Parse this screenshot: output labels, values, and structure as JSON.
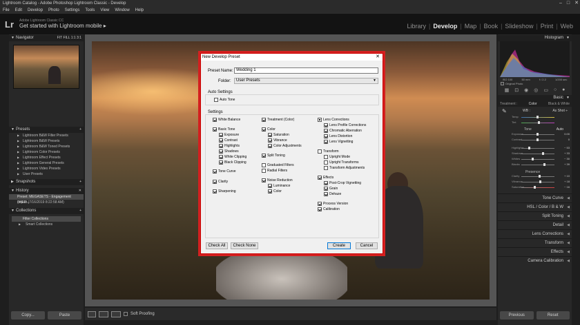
{
  "window": {
    "title": "Lightroom Catalog - Adobe Photoshop Lightroom Classic - Develop"
  },
  "menu": [
    "File",
    "Edit",
    "Develop",
    "Photo",
    "Settings",
    "Tools",
    "View",
    "Window",
    "Help"
  ],
  "identity": {
    "logo": "Lr",
    "product": "Adobe Lightroom Classic CC",
    "tagline": "Get started with Lightroom mobile ▸"
  },
  "modules": [
    "Library",
    "Develop",
    "Map",
    "Book",
    "Slideshow",
    "Print",
    "Web"
  ],
  "active_module": "Develop",
  "left": {
    "navigator": {
      "title": "Navigator",
      "options": [
        "FIT",
        "FILL",
        "1:1",
        "3:1"
      ]
    },
    "presets": {
      "title": "Presets",
      "items": [
        "Lightroom B&W Filter Presets",
        "Lightroom B&W Presets",
        "Lightroom B&W Toned Presets",
        "Lightroom Color Presets",
        "Lightroom Effect Presets",
        "Lightroom General Presets",
        "Lightroom Video Presets",
        "User Presets"
      ]
    },
    "snapshots": {
      "title": "Snapshots"
    },
    "history": {
      "title": "History",
      "items": [
        "Preset: MEGASETS - Engagement (WED...",
        "Import (7/16/2019 8:22:58 AM)"
      ]
    },
    "collections": {
      "title": "Collections",
      "items": [
        "Filter Collections",
        "Smart Collections"
      ]
    },
    "copy_label": "Copy...",
    "paste_label": "Paste"
  },
  "toolbar": {
    "soft_proofing": "Soft Proofing"
  },
  "dialog": {
    "title": "New Develop Preset",
    "preset_name_label": "Preset Name:",
    "preset_name_value": "Wedding 1",
    "folder_label": "Folder:",
    "folder_value": "User Presets",
    "auto_settings_label": "Auto Settings",
    "auto_tone": "Auto Tone",
    "settings_label": "Settings",
    "col1": [
      "White Balance",
      "Basic Tone",
      "Exposure",
      "Contrast",
      "Highlights",
      "Shadows",
      "White Clipping",
      "Black Clipping",
      "Tone Curve",
      "Clarity",
      "Sharpening"
    ],
    "col2": [
      "Treatment (Color)",
      "Color",
      "Saturation",
      "Vibrance",
      "Color Adjustments",
      "Split Toning",
      "Graduated Filters",
      "Radial Filters",
      "Noise Reduction",
      "Luminance",
      "Color"
    ],
    "col3": [
      "Lens Corrections",
      "Lens Profile Corrections",
      "Chromatic Aberration",
      "Lens Distortion",
      "Lens Vignetting",
      "Transform",
      "Upright Mode",
      "Upright Transforms",
      "Transform Adjustments",
      "Effects",
      "Post-Crop Vignetting",
      "Grain",
      "Dehaze",
      "Process Version",
      "Calibration"
    ],
    "check_all": "Check All",
    "check_none": "Check None",
    "create": "Create",
    "cancel": "Cancel"
  },
  "right": {
    "histogram": {
      "title": "Histogram",
      "info": [
        "ISO 100",
        "50 mm",
        "f / 2.2",
        "1/200 sec"
      ],
      "original_photo": "Original Photo"
    },
    "basic": {
      "title": "Basic",
      "treatment_label": "Treatment :",
      "color": "Color",
      "bw": "Black & White",
      "wb_label": "WB :",
      "wb_value": "As Shot ÷",
      "temp": "Temp",
      "tint": "Tint",
      "tone": "Tone",
      "auto": "Auto",
      "sliders": [
        {
          "name": "Exposure",
          "value": "0.00"
        },
        {
          "name": "Contrast",
          "value": "0"
        },
        {
          "name": "Highlights",
          "value": "− 53"
        },
        {
          "name": "Shadows",
          "value": "+ 33"
        },
        {
          "name": "Whites",
          "value": "− 30"
        },
        {
          "name": "Blacks",
          "value": "+ 39"
        }
      ],
      "presence": "Presence",
      "presence_sliders": [
        {
          "name": "Clarity",
          "value": "+ 10"
        },
        {
          "name": "Vibrance",
          "value": "+ 18"
        },
        {
          "name": "Saturation",
          "value": "− 16"
        }
      ]
    },
    "sections": [
      "Tone Curve",
      "HSL / Color / B & W",
      "Split Toning",
      "Detail",
      "Lens Corrections",
      "Transform",
      "Effects",
      "Camera Calibration"
    ],
    "previous_label": "Previous",
    "reset_label": "Reset"
  }
}
